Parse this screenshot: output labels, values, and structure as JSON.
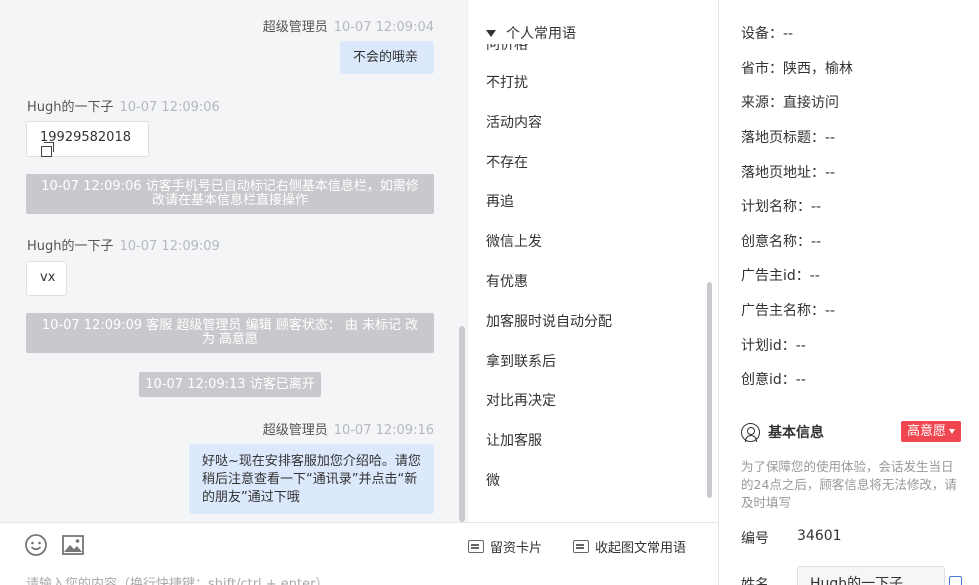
{
  "chat": {
    "messages": [
      {
        "sender": "超级管理员",
        "time": "10-07 12:09:04",
        "text": "不会的哦亲"
      },
      {
        "sender": "Hugh的一下子",
        "time": "10-07 12:09:06",
        "text": "19929582018"
      },
      {
        "system": "10-07 12:09:06 访客手机号已自动标记右侧基本信息栏，如需修改请在基本信息栏直接操作"
      },
      {
        "sender": "Hugh的一下子",
        "time": "10-07 12:09:09",
        "text": "vx"
      },
      {
        "system": "10-07 12:09:09 客服 超级管理员 编辑 顾客状态： 由 未标记 改为 高意愿"
      },
      {
        "system": "10-07 12:09:13 访客已离开"
      },
      {
        "sender": "超级管理员",
        "time": "10-07 12:09:16",
        "text": "好哒~现在安排客服加您介绍哈。请您稍后注意查看一下“通讯录”并点击“新的朋友”通过下哦"
      }
    ]
  },
  "input": {
    "emoji_icon": "smile-icon",
    "image_icon": "image-icon",
    "leave_card_label": "留资卡片",
    "collapse_phrases_label": "收起图文常用语",
    "placeholder": "请输入您的内容（换行快捷键：shift/ctrl + enter）"
  },
  "phrases": {
    "header": "个人常用语",
    "cut_item": "问价格",
    "items": [
      "不打扰",
      "活动内容",
      "不存在",
      "再追",
      "微信上发",
      "有优惠",
      "加客服时说自动分配",
      "拿到联系后",
      "对比再决定",
      "让加客服",
      "微"
    ]
  },
  "info": {
    "rows": [
      {
        "label": "设备：",
        "value": "--"
      },
      {
        "label": "省市：",
        "value": "陕西，榆林"
      },
      {
        "label": "来源：",
        "value": "直接访问"
      },
      {
        "label": "落地页标题：",
        "value": "--"
      },
      {
        "label": "落地页地址：",
        "value": "--"
      },
      {
        "label": "计划名称：",
        "value": "--"
      },
      {
        "label": "创意名称：",
        "value": "--"
      },
      {
        "label": "广告主id：",
        "value": "--"
      },
      {
        "label": "广告主名称：",
        "value": "--"
      },
      {
        "label": "计划id：",
        "value": "--"
      },
      {
        "label": "创意id：",
        "value": "--"
      }
    ],
    "basic_title": "基本信息",
    "intent": "高意愿",
    "intent_color": "#f0464f",
    "notice": "为了保障您的使用体验，会话发生当日的24点之后，顾客信息将无法修改，请及时填写",
    "id_label": "编号",
    "id_value": "34601",
    "name_label": "姓名",
    "name_value": "Hugh的一下子"
  }
}
